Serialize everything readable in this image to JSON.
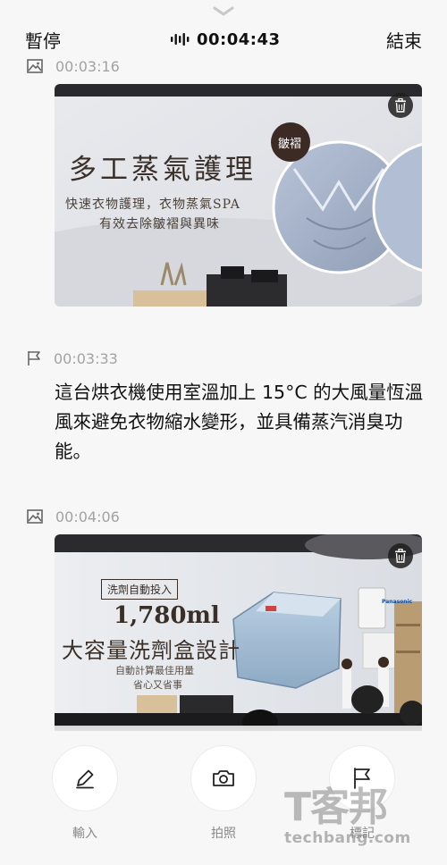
{
  "header": {
    "pause_label": "暫停",
    "timer": "00:04:43",
    "end_label": "結束"
  },
  "entries": [
    {
      "type": "photo",
      "time": "00:03:16",
      "image": {
        "headline": "多工蒸氣護理",
        "line1": "快速衣物護理，衣物蒸氣SPA",
        "line2": "有效去除皺褶與異味",
        "badge": "皺褶"
      }
    },
    {
      "type": "note",
      "time": "00:03:33",
      "text": "這台烘衣機使用室溫加上 15°C 的大風量恆溫風來避免衣物縮水變形，並具備蒸汽消臭功能。"
    },
    {
      "type": "photo",
      "time": "00:04:06",
      "image": {
        "tag": "洗劑自動投入",
        "amount": "1,780ml",
        "headline": "大容量洗劑盒設計",
        "line1": "自動計算最佳用量",
        "line2": "省心又省事",
        "brand": "Panasonic"
      }
    }
  ],
  "actions": [
    {
      "label": "輸入",
      "icon": "pen-icon"
    },
    {
      "label": "拍照",
      "icon": "camera-icon"
    },
    {
      "label": "標記",
      "icon": "flag-icon"
    }
  ],
  "watermark": {
    "logo": "T客邦",
    "site": "techbang.com"
  }
}
